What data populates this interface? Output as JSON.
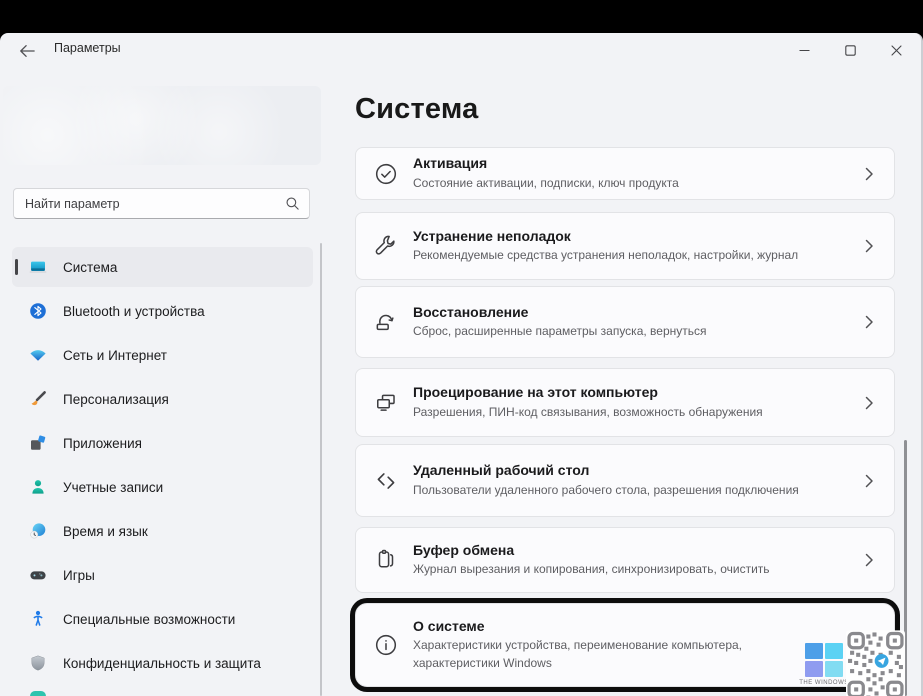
{
  "window": {
    "app_title": "Параметры",
    "controls": [
      "minimize-icon",
      "maximize-icon",
      "close-icon"
    ]
  },
  "sidebar": {
    "search_placeholder": "Найти параметр",
    "items": [
      {
        "label": "Система",
        "icon": "system-icon",
        "selected": true
      },
      {
        "label": "Bluetooth и устройства",
        "icon": "bluetooth-icon",
        "selected": false
      },
      {
        "label": "Сеть и Интернет",
        "icon": "network-icon",
        "selected": false
      },
      {
        "label": "Персонализация",
        "icon": "personalization-icon",
        "selected": false
      },
      {
        "label": "Приложения",
        "icon": "apps-icon",
        "selected": false
      },
      {
        "label": "Учетные записи",
        "icon": "accounts-icon",
        "selected": false
      },
      {
        "label": "Время и язык",
        "icon": "time-language-icon",
        "selected": false
      },
      {
        "label": "Игры",
        "icon": "gaming-icon",
        "selected": false
      },
      {
        "label": "Специальные возможности",
        "icon": "accessibility-icon",
        "selected": false
      },
      {
        "label": "Конфиденциальность и защита",
        "icon": "privacy-icon",
        "selected": false
      }
    ]
  },
  "main": {
    "title": "Система",
    "cards": [
      {
        "title": "Активация",
        "subtitle": "Состояние активации, подписки, ключ продукта",
        "icon": "activation-icon"
      },
      {
        "title": "Устранение неполадок",
        "subtitle": "Рекомендуемые средства устранения неполадок, настройки, журнал",
        "icon": "troubleshoot-icon"
      },
      {
        "title": "Восстановление",
        "subtitle": "Сброс, расширенные параметры запуска, вернуться",
        "icon": "recovery-icon"
      },
      {
        "title": "Проецирование на этот компьютер",
        "subtitle": "Разрешения, ПИН-код связывания, возможность обнаружения",
        "icon": "projection-icon"
      },
      {
        "title": "Удаленный рабочий стол",
        "subtitle": "Пользователи удаленного рабочего стола, разрешения подключения",
        "icon": "remote-desktop-icon"
      },
      {
        "title": "Буфер обмена",
        "subtitle": "Журнал вырезания и копирования, синхронизировать, очистить",
        "icon": "clipboard-icon"
      },
      {
        "title": "О системе",
        "subtitle": "Характеристики устройства, переименование компьютера, характеристики Windows",
        "icon": "about-icon",
        "highlighted": true
      }
    ]
  },
  "watermark": {
    "brand": "THE WINDOWS"
  },
  "colors": {
    "window_bg": "#f2f3f6",
    "card_bg": "#fbfbfd",
    "selected_item_bg": "#e9eaee",
    "accent_bar": "#454548",
    "highlight_ring": "#0d0d0d",
    "logo_blue": "#4d9fe8",
    "logo_cyan": "#5bd2f4",
    "telegram_blue": "#38a5e0"
  }
}
